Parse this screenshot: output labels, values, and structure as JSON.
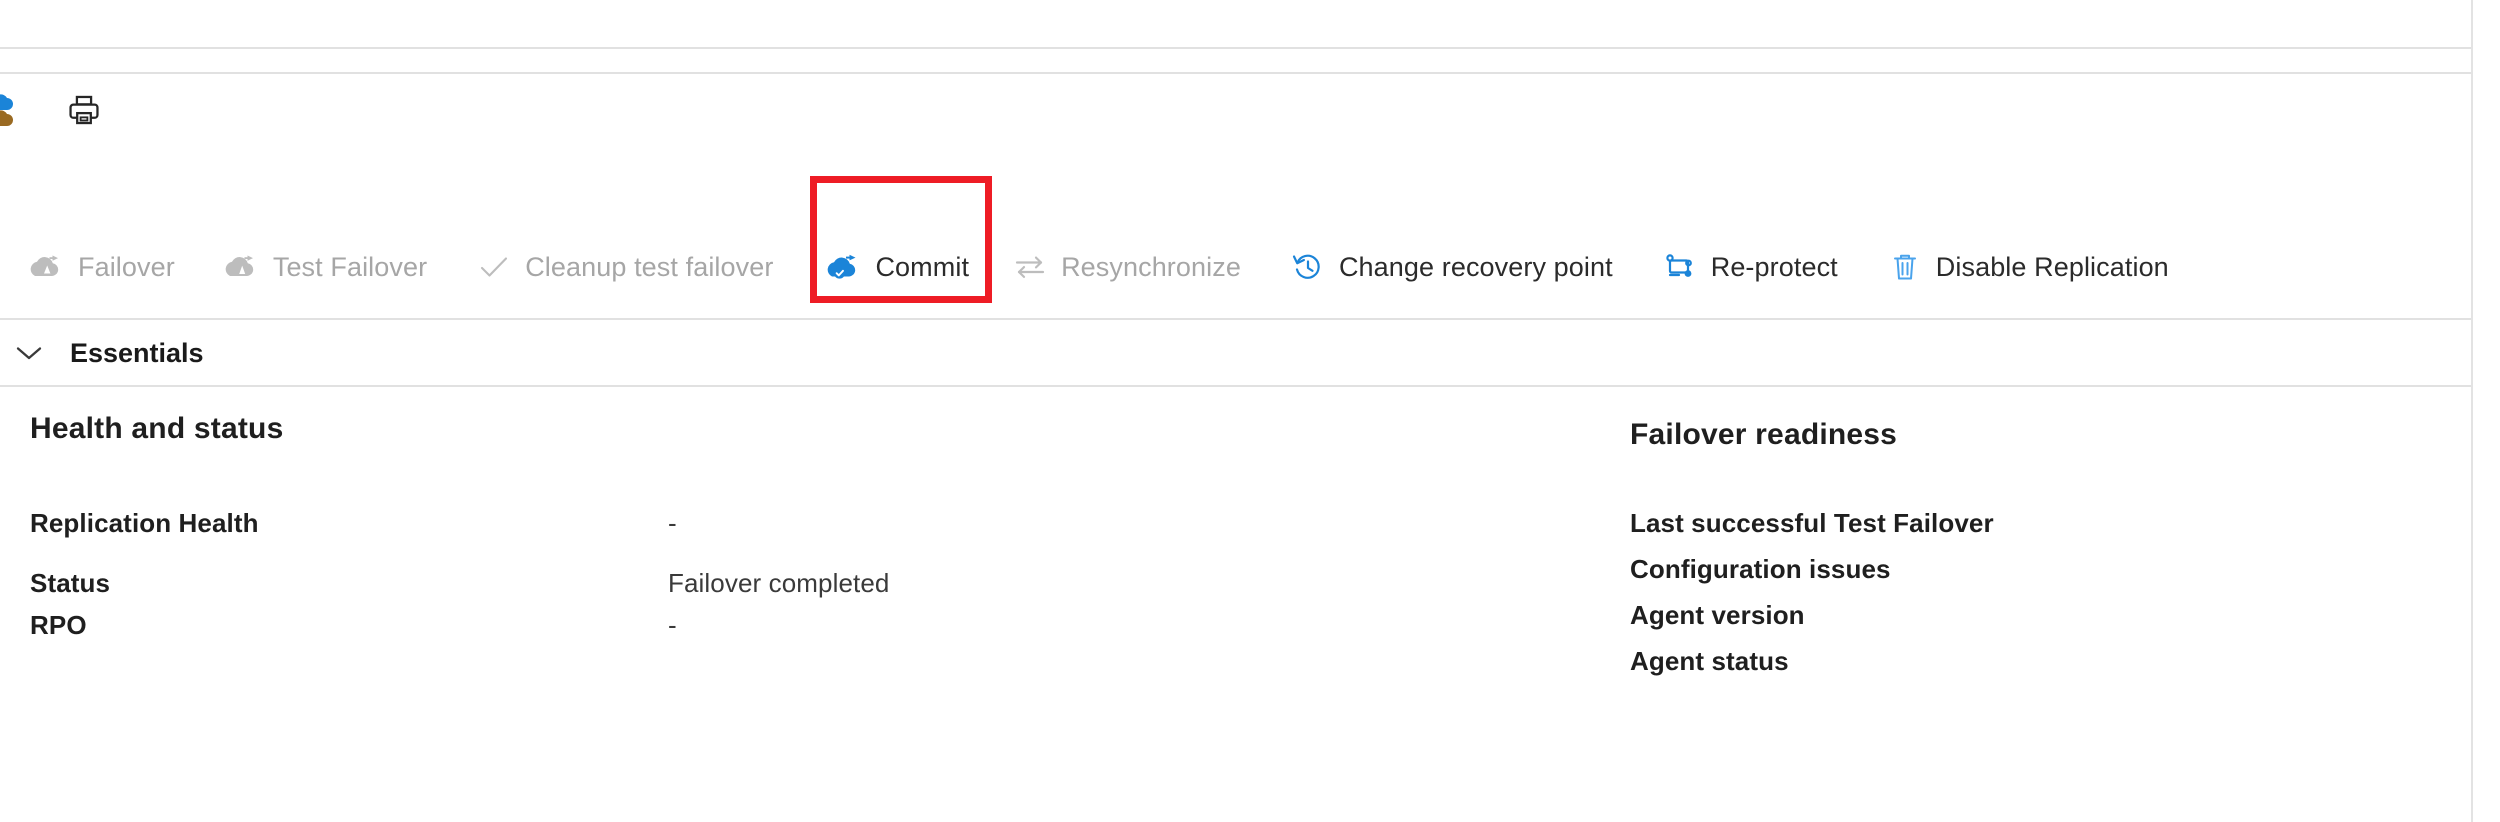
{
  "window": {
    "print_icon": "printer-icon",
    "edge_icon": "cloud-partial-icon"
  },
  "toolbar": {
    "commands": [
      {
        "id": "failover",
        "label": "Failover",
        "icon": "cloud-failover-icon",
        "enabled": false,
        "highlighted": false
      },
      {
        "id": "test-failover",
        "label": "Test Failover",
        "icon": "cloud-test-failover-icon",
        "enabled": false,
        "highlighted": false
      },
      {
        "id": "cleanup",
        "label": "Cleanup test failover",
        "icon": "checkmark-icon",
        "enabled": false,
        "highlighted": false
      },
      {
        "id": "commit",
        "label": "Commit",
        "icon": "cloud-commit-check-icon",
        "enabled": true,
        "highlighted": true
      },
      {
        "id": "resynchronize",
        "label": "Resynchronize",
        "icon": "sync-arrows-icon",
        "enabled": false,
        "highlighted": false
      },
      {
        "id": "change-recovery",
        "label": "Change recovery point",
        "icon": "clock-history-icon",
        "enabled": true,
        "highlighted": false
      },
      {
        "id": "re-protect",
        "label": "Re-protect",
        "icon": "re-protect-icon",
        "enabled": true,
        "highlighted": false
      },
      {
        "id": "disable-repl",
        "label": "Disable Replication",
        "icon": "trash-icon",
        "enabled": true,
        "highlighted": false
      }
    ],
    "highlight_color": "#ee1c25"
  },
  "essentials": {
    "label": "Essentials",
    "chevron": "chevron-down-icon",
    "expanded": true
  },
  "details": {
    "left": {
      "title": "Health and status",
      "rows": [
        {
          "label": "Replication Health",
          "value": "-"
        },
        {
          "label": "Status",
          "value": "Failover completed"
        },
        {
          "label": "RPO",
          "value": "-"
        }
      ]
    },
    "right": {
      "title": "Failover readiness",
      "rows": [
        {
          "label": "Last successful Test Failover",
          "value": ""
        },
        {
          "label": "Configuration issues",
          "value": ""
        },
        {
          "label": "Agent version",
          "value": ""
        },
        {
          "label": "Agent status",
          "value": ""
        }
      ]
    }
  }
}
